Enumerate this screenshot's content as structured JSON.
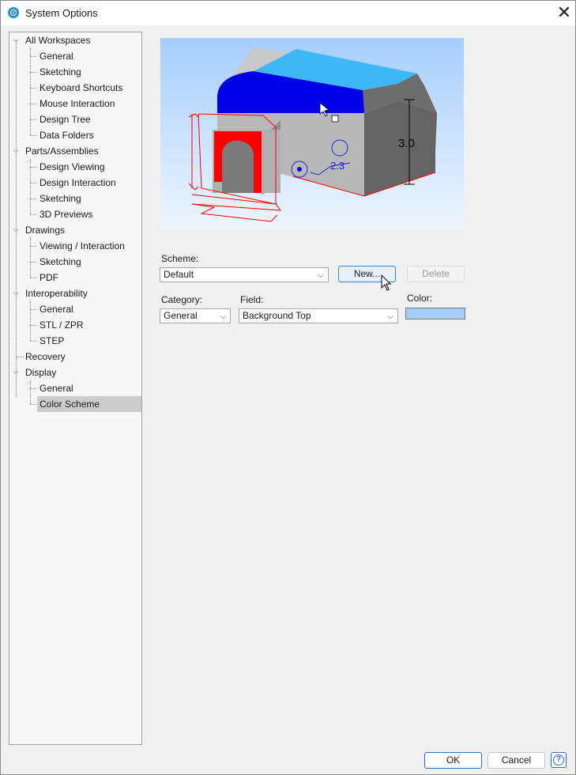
{
  "window": {
    "title": "System Options"
  },
  "tree": [
    {
      "label": "All Workspaces",
      "children": [
        "General",
        "Sketching",
        "Keyboard Shortcuts",
        "Mouse Interaction",
        "Design Tree",
        "Data Folders"
      ]
    },
    {
      "label": "Parts/Assemblies",
      "children": [
        "Design Viewing",
        "Design Interaction",
        "Sketching",
        "3D Previews"
      ]
    },
    {
      "label": "Drawings",
      "children": [
        "Viewing / Interaction",
        "Sketching",
        "PDF"
      ]
    },
    {
      "label": "Interoperability",
      "children": [
        "General",
        "STL / ZPR",
        "STEP"
      ]
    },
    {
      "label": "Recovery",
      "children": []
    },
    {
      "label": "Display",
      "children": [
        "General",
        "Color Scheme"
      ]
    }
  ],
  "selected_item": "Color Scheme",
  "preview": {
    "height_dimension": "3.0",
    "diameter_dimension": "2.3"
  },
  "scheme": {
    "label": "Scheme:",
    "value": "Default"
  },
  "buttons": {
    "new": "New...",
    "delete": "Delete",
    "ok": "OK",
    "cancel": "Cancel"
  },
  "category": {
    "label": "Category:",
    "value": "General"
  },
  "field": {
    "label": "Field:",
    "value": "Background Top"
  },
  "color": {
    "label": "Color:",
    "value": "#a6cdfb"
  },
  "colors": {
    "accent": "#2a6fb8",
    "selection": "#cccccc",
    "model_blue": "#0000e6",
    "model_top": "#3eb8f5",
    "cut_red": "#ff0000"
  },
  "icons": [
    "app-icon",
    "close-icon",
    "chevron-down-icon",
    "dropdown-arrow-icon",
    "help-icon",
    "mouse-pointer-icon"
  ]
}
